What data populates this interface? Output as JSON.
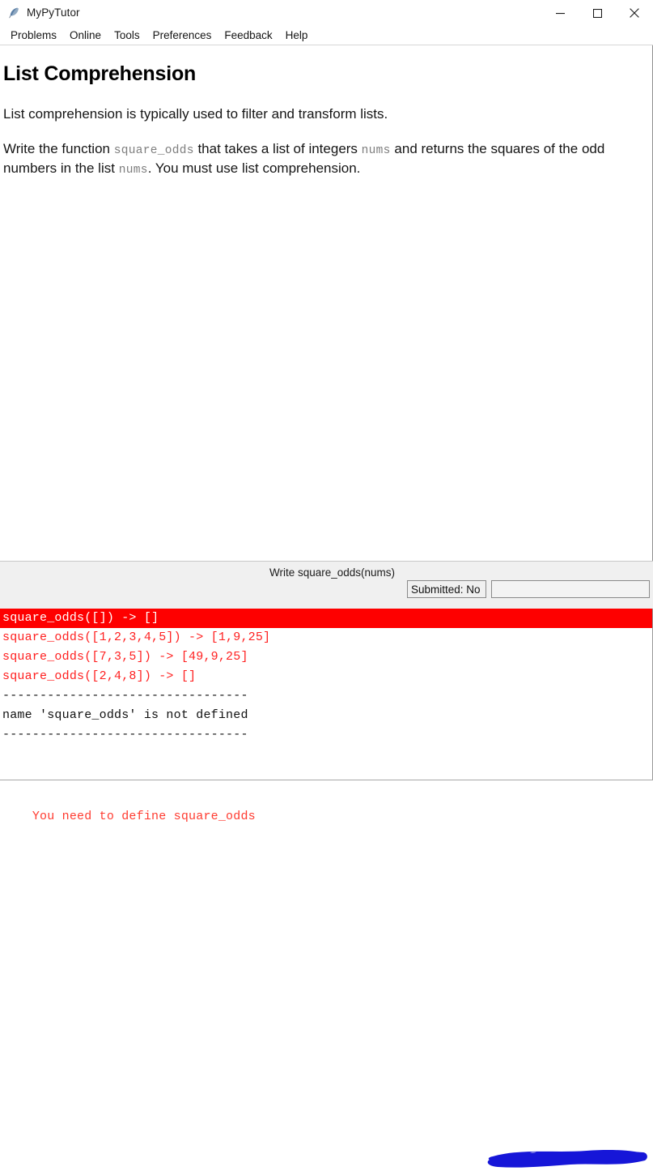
{
  "window": {
    "title": "MyPyTutor",
    "icon": "feather-quill-icon",
    "controls": {
      "minimize": "minimize-icon",
      "maximize": "maximize-icon",
      "close": "close-icon"
    }
  },
  "menubar": {
    "items": [
      {
        "label": "Problems"
      },
      {
        "label": "Online"
      },
      {
        "label": "Tools"
      },
      {
        "label": "Preferences"
      },
      {
        "label": "Feedback"
      },
      {
        "label": "Help"
      }
    ]
  },
  "problem": {
    "title": "List Comprehension",
    "intro": "List comprehension is typically used to filter and transform lists.",
    "task": {
      "part1": "Write the function ",
      "code1": "square_odds",
      "part2": " that takes a list of integers ",
      "code2": "nums",
      "part3": " and returns the squares of the odd numbers in the list ",
      "code3": "nums",
      "part4": ". You must use list comprehension."
    }
  },
  "editor": {
    "strip_title": "Write square_odds(nums)",
    "submitted_label": "Submitted: No",
    "progress_value": "",
    "redaction_color": "#1616d8"
  },
  "results": {
    "lines": [
      {
        "text": "square_odds([]) -> []",
        "state": "selected"
      },
      {
        "text": "square_odds([1,2,3,4,5]) -> [1,9,25]",
        "state": "fail"
      },
      {
        "text": "square_odds([7,3,5]) -> [49,9,25]",
        "state": "fail"
      },
      {
        "text": "square_odds([2,4,8]) -> []",
        "state": "fail"
      },
      {
        "text": "---------------------------------",
        "state": "plain"
      },
      {
        "text": "name 'square_odds' is not defined",
        "state": "plain"
      },
      {
        "text": "---------------------------------",
        "state": "plain"
      }
    ]
  },
  "footer": {
    "message": "You need to define square_odds"
  }
}
